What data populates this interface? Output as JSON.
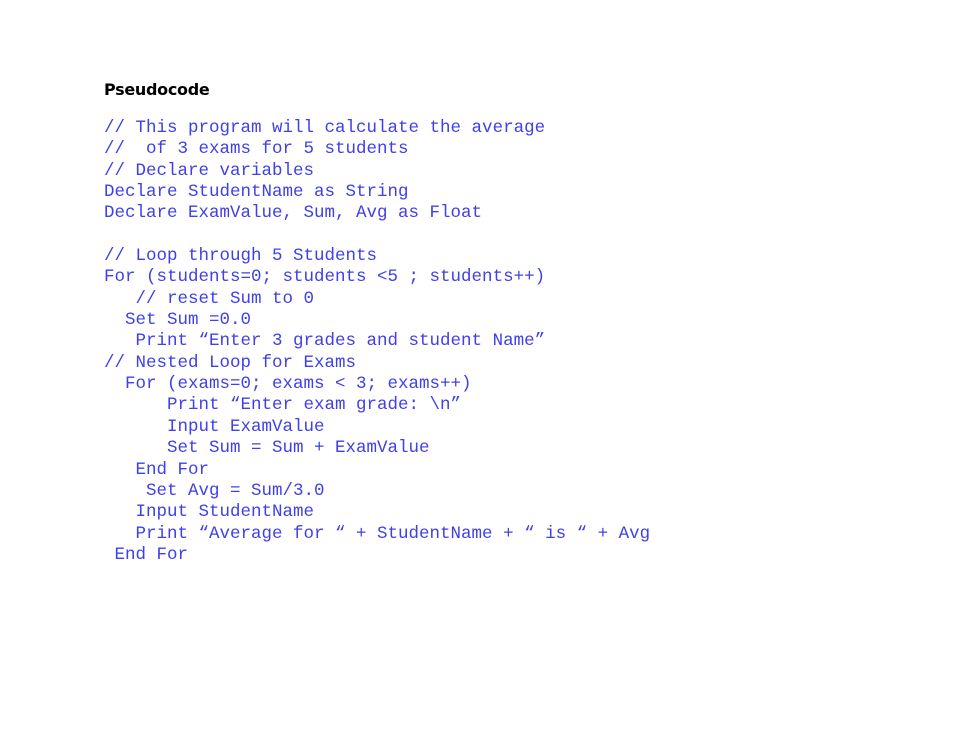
{
  "document": {
    "heading": "Pseudocode",
    "code_color": "#4040e8",
    "code_lines": [
      "// This program will calculate the average",
      "//  of 3 exams for 5 students",
      "// Declare variables",
      "Declare StudentName as String",
      "Declare ExamValue, Sum, Avg as Float",
      "",
      "// Loop through 5 Students",
      "For (students=0; students <5 ; students++)",
      "   // reset Sum to 0",
      "  Set Sum =0.0",
      "   Print “Enter 3 grades and student Name”",
      "// Nested Loop for Exams",
      "  For (exams=0; exams < 3; exams++)",
      "      Print “Enter exam grade: \\n”",
      "      Input ExamValue",
      "      Set Sum = Sum + ExamValue",
      "   End For",
      "    Set Avg = Sum/3.0",
      "   Input StudentName",
      "   Print “Average for “ + StudentName + “ is “ + Avg",
      " End For"
    ]
  }
}
